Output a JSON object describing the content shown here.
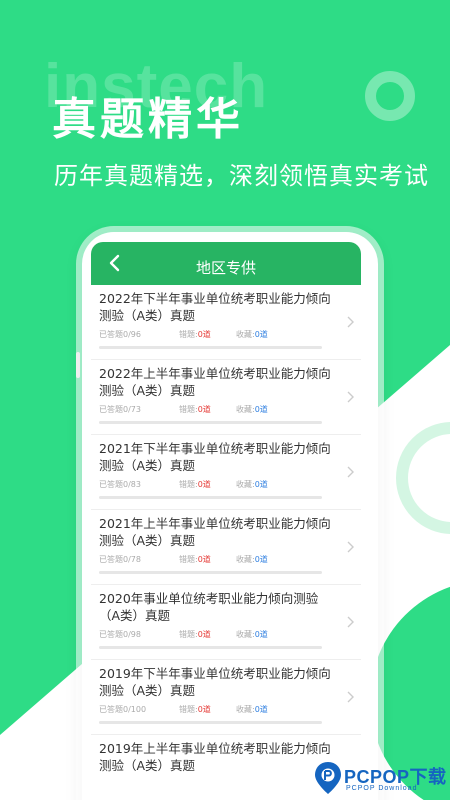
{
  "banner": {
    "watermark": "instech",
    "title": "真题精华",
    "subtitle": "历年真题精选，深刻领悟真实考试"
  },
  "header": {
    "title": "地区专供",
    "back_icon": "chevron-left-icon"
  },
  "list": {
    "items": [
      {
        "title": "2022年下半年事业单位统考职业能力倾向测验（A类）真题",
        "answered": "已答题0/96",
        "wrong_label": "错题:",
        "wrong_count": "0道",
        "collect_label": "收藏:",
        "collect_count": "0道"
      },
      {
        "title": "2022年上半年事业单位统考职业能力倾向测验（A类）真题",
        "answered": "已答题0/73",
        "wrong_label": "错题:",
        "wrong_count": "0道",
        "collect_label": "收藏:",
        "collect_count": "0道"
      },
      {
        "title": "2021年下半年事业单位统考职业能力倾向测验（A类）真题",
        "answered": "已答题0/83",
        "wrong_label": "错题:",
        "wrong_count": "0道",
        "collect_label": "收藏:",
        "collect_count": "0道"
      },
      {
        "title": "2021年上半年事业单位统考职业能力倾向测验（A类）真题",
        "answered": "已答题0/78",
        "wrong_label": "错题:",
        "wrong_count": "0道",
        "collect_label": "收藏:",
        "collect_count": "0道"
      },
      {
        "title": "2020年事业单位统考职业能力倾向测验（A类）真题",
        "answered": "已答题0/98",
        "wrong_label": "错题:",
        "wrong_count": "0道",
        "collect_label": "收藏:",
        "collect_count": "0道"
      },
      {
        "title": "2019年下半年事业单位统考职业能力倾向测验（A类）真题",
        "answered": "已答题0/100",
        "wrong_label": "错题:",
        "wrong_count": "0道",
        "collect_label": "收藏:",
        "collect_count": "0道"
      },
      {
        "title": "2019年上半年事业单位统考职业能力倾向测验（A类）真题",
        "answered": "",
        "wrong_label": "",
        "wrong_count": "",
        "collect_label": "",
        "collect_count": ""
      }
    ]
  },
  "logo": {
    "text": "PCPOP下载",
    "sub": "PCPOP Download"
  },
  "colors": {
    "brand_green": "#2edc86",
    "header_green": "#27b463",
    "wrong_red": "#e53935",
    "collect_blue": "#2f7fe0",
    "logo_blue": "#1565c0"
  }
}
